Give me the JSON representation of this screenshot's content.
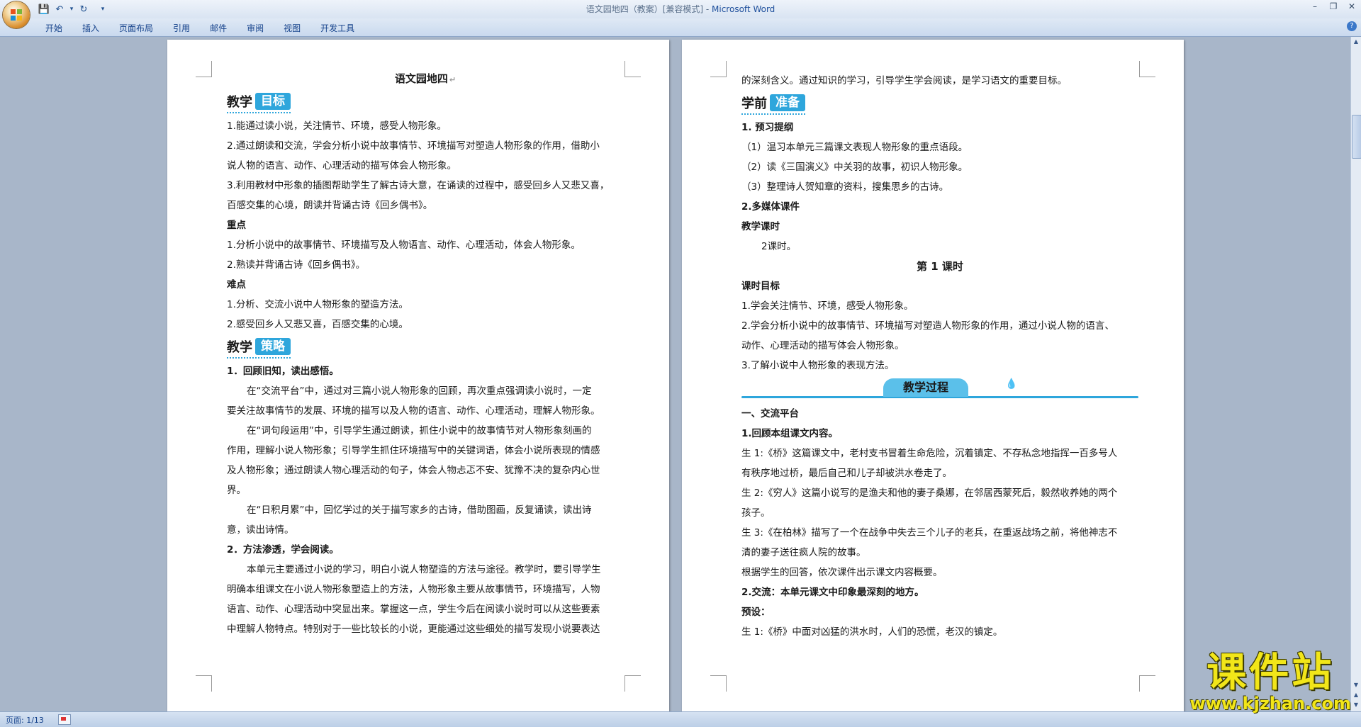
{
  "window": {
    "title_doc": "语文园地四（教案）[兼容模式] - ",
    "title_app": "Microsoft Word",
    "controls": {
      "minimize": "–",
      "restore": "❐",
      "close": "✕"
    }
  },
  "qat": {
    "save_icon": "💾",
    "undo_icon": "↶",
    "undo_arrow": "▾",
    "redo_icon": "↻",
    "customize": "▾"
  },
  "ribbon": {
    "tabs": [
      "开始",
      "插入",
      "页面布局",
      "引用",
      "邮件",
      "审阅",
      "视图",
      "开发工具"
    ],
    "help": "?"
  },
  "page1": {
    "title": "语文园地四",
    "goal_badge": {
      "plain": "教学",
      "box": "目标"
    },
    "goals": [
      "1.能通过读小说，关注情节、环境，感受人物形象。",
      "2.通过朗读和交流，学会分析小说中故事情节、环境描写对塑造人物形象的作用，借助小",
      "说人物的语言、动作、心理活动的描写体会人物形象。",
      "3.利用教材中形象的插图帮助学生了解古诗大意，在诵读的过程中，感受回乡人又悲又喜，",
      "百感交集的心境，朗读并背诵古诗《回乡偶书》。"
    ],
    "key_heading": "重点",
    "key_points": [
      "1.分析小说中的故事情节、环境描写及人物语言、动作、心理活动，体会人物形象。",
      "2.熟读并背诵古诗《回乡偶书》。"
    ],
    "hard_heading": "难点",
    "hard_points": [
      "1.分析、交流小说中人物形象的塑造方法。",
      "2.感受回乡人又悲又喜，百感交集的心境。"
    ],
    "strategy_badge": {
      "plain": "教学",
      "box": "策略"
    },
    "strategy_h1": "1．回顾旧知，读出感悟。",
    "strategy_p1": [
      "在“交流平台”中，通过对三篇小说人物形象的回顾，再次重点强调读小说时，一定",
      "要关注故事情节的发展、环境的描写以及人物的语言、动作、心理活动，理解人物形象。"
    ],
    "strategy_p2": [
      "在“词句段运用”中，引导学生通过朗读，抓住小说中的故事情节对人物形象刻画的",
      "作用，理解小说人物形象；引导学生抓住环境描写中的关键词语，体会小说所表现的情感",
      "及人物形象；通过朗读人物心理活动的句子，体会人物忐忑不安、犹豫不决的复杂内心世",
      "界。"
    ],
    "strategy_p3": [
      "在“日积月累”中，回忆学过的关于描写家乡的古诗，借助图画，反复诵读，读出诗",
      "意，读出诗情。"
    ],
    "strategy_h2": "2．方法渗透，学会阅读。",
    "strategy_p4": [
      "本单元主要通过小说的学习，明白小说人物塑造的方法与途径。教学时，要引导学生",
      "明确本组课文在小说人物形象塑造上的方法，人物形象主要从故事情节，环境描写，人物",
      "语言、动作、心理活动中突显出来。掌握这一点，学生今后在阅读小说时可以从这些要素",
      "中理解人物特点。特别对于一些比较长的小说，更能通过这些细处的描写发现小说要表达"
    ]
  },
  "page2": {
    "cont_line": "的深刻含义。通过知识的学习，引导学生学会阅读，是学习语文的重要目标。",
    "prep_badge": {
      "plain": "学前",
      "box": "准备"
    },
    "prep_h1": "1. 预习提纲",
    "prep_items": [
      "（1）温习本单元三篇课文表现人物形象的重点语段。",
      "（2）读《三国演义》中关羽的故事，初识人物形象。",
      "（3）整理诗人贺知章的资料，搜集思乡的古诗。"
    ],
    "prep_h2": "2.多媒体课件",
    "hours_heading": "教学课时",
    "hours_value": "2课时。",
    "lesson_title": "第 1 课时",
    "lesson_goal_heading": "课时目标",
    "lesson_goals": [
      "1.学会关注情节、环境，感受人物形象。",
      "2.学会分析小说中的故事情节、环境描写对塑造人物形象的作用，通过小说人物的语言、",
      "动作、心理活动的描写体会人物形象。",
      "3.了解小说中人物形象的表现方法。"
    ],
    "process_banner": "教学过程",
    "sec1": "一、交流平台",
    "sec1_h": "1.回顾本组课文内容。",
    "sec1_lines": [
      "生 1:《桥》这篇课文中，老村支书冒着生命危险，沉着镇定、不存私念地指挥一百多号人",
      "有秩序地过桥，最后自己和儿子却被洪水卷走了。",
      "生 2:《穷人》这篇小说写的是渔夫和他的妻子桑娜，在邻居西蒙死后，毅然收养她的两个",
      "孩子。",
      "生 3:《在柏林》描写了一个在战争中失去三个儿子的老兵，在重返战场之前，将他神志不",
      "清的妻子送往疯人院的故事。",
      "根据学生的回答，依次课件出示课文内容概要。"
    ],
    "sec1_h2": "2.交流：本单元课文中印象最深刻的地方。",
    "preset": "预设：",
    "preset_line": "生 1:《桥》中面对凶猛的洪水时，人们的恐慌，老汉的镇定。"
  },
  "para_mark": "↵",
  "status": {
    "page": "页面: 1/13"
  },
  "watermark": {
    "big": "课件站",
    "url": "www.kjzhan.com"
  },
  "colors": {
    "accent": "#2ea6dc",
    "ribbon_text": "#15428b",
    "watermark": "#f2e619"
  }
}
